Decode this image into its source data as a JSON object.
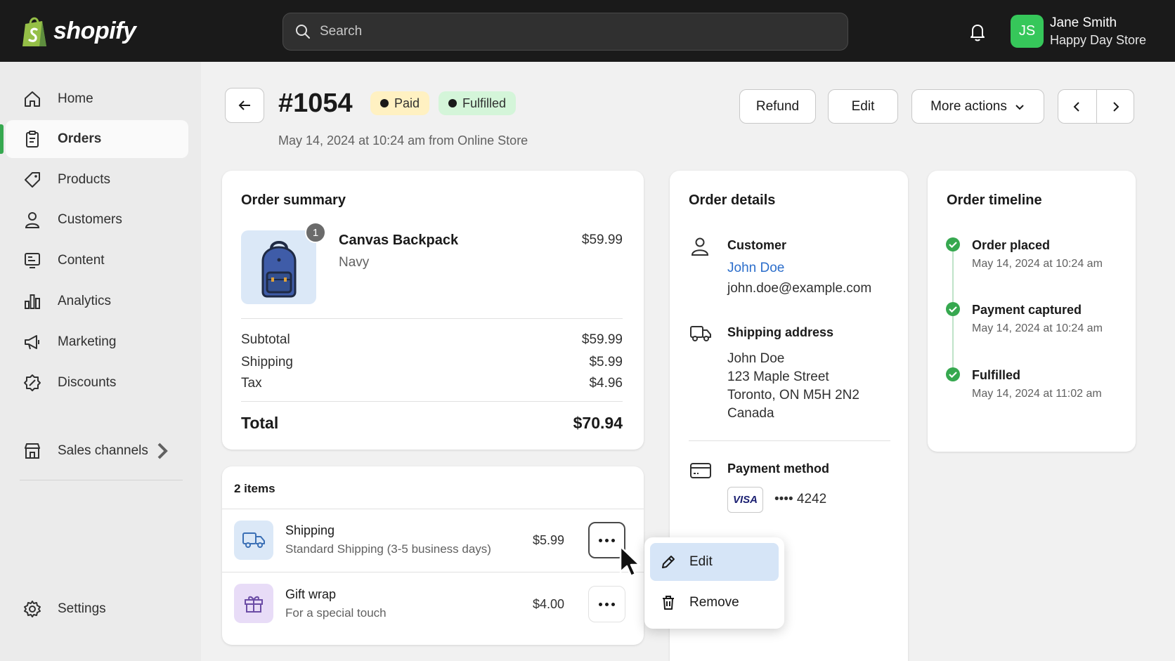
{
  "app": {
    "logo_text": "shopify",
    "search_placeholder": "Search"
  },
  "user": {
    "initials": "JS",
    "name": "Jane Smith",
    "store": "Happy Day Store"
  },
  "sidebar": {
    "items": [
      {
        "label": "Home",
        "icon": "home-icon"
      },
      {
        "label": "Orders",
        "icon": "orders-icon",
        "active": true
      },
      {
        "label": "Products",
        "icon": "tag-icon"
      },
      {
        "label": "Customers",
        "icon": "person-icon"
      },
      {
        "label": "Content",
        "icon": "content-icon"
      },
      {
        "label": "Analytics",
        "icon": "bar-chart-icon"
      },
      {
        "label": "Marketing",
        "icon": "megaphone-icon"
      },
      {
        "label": "Discounts",
        "icon": "discount-icon"
      }
    ],
    "sales_channels": "Sales channels",
    "settings": "Settings"
  },
  "order": {
    "number": "#1054",
    "badges": {
      "paid": "Paid",
      "fulfilled": "Fulfilled"
    },
    "meta": "May 14, 2024 at 10:24 am from Online Store",
    "actions": {
      "refund": "Refund",
      "edit": "Edit",
      "more": "More actions"
    }
  },
  "summary": {
    "title": "Order summary",
    "product": {
      "name": "Canvas Backpack",
      "variant": "Navy",
      "price": "$59.99",
      "quantity": "1"
    },
    "subtotal_label": "Subtotal",
    "subtotal": "$59.99",
    "shipping_label": "Shipping",
    "shipping": "$5.99",
    "tax_label": "Tax",
    "tax": "$4.96",
    "total_label": "Total",
    "total": "$70.94"
  },
  "items": {
    "count_label": "2 items",
    "list": [
      {
        "name": "Shipping",
        "desc": "Standard Shipping (3-5 business days)",
        "price": "$5.99"
      },
      {
        "name": "Gift wrap",
        "desc": "For a special touch",
        "price": "$4.00"
      }
    ]
  },
  "details": {
    "title": "Order details",
    "customer_label": "Customer",
    "customer_name": "John Doe",
    "customer_email": "john.doe@example.com",
    "shipping_label": "Shipping address",
    "address": [
      "John Doe",
      "123 Maple Street",
      "Toronto, ON M5H 2N2",
      "Canada"
    ],
    "payment_label": "Payment method",
    "card_brand": "VISA",
    "card_last4": "•••• 4242"
  },
  "timeline": {
    "title": "Order timeline",
    "events": [
      {
        "title": "Order placed",
        "time": "May 14, 2024 at 10:24 am"
      },
      {
        "title": "Payment captured",
        "time": "May 14, 2024 at 10:24 am"
      },
      {
        "title": "Fulfilled",
        "time": "May 14, 2024 at 11:02 am"
      }
    ]
  },
  "menu": {
    "edit": "Edit",
    "remove": "Remove"
  },
  "colors": {
    "topbar": "#1a1a1a",
    "accent_green": "#36a84f",
    "link_blue": "#2c6ecb",
    "paid_badge": "#fff1c2",
    "fulfilled_badge": "#d4f5d9"
  }
}
